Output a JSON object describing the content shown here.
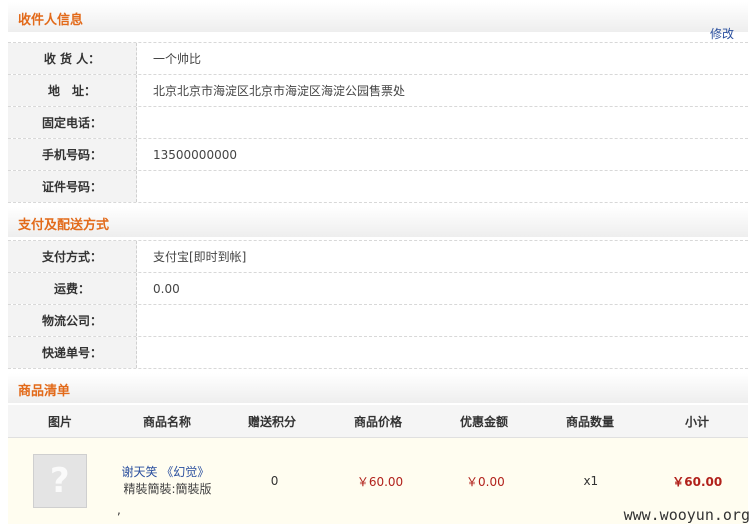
{
  "receiver": {
    "title": "收件人信息",
    "edit_label": "修改",
    "rows": [
      {
        "label": "收 货 人：",
        "value": "一个帅比"
      },
      {
        "label": "地　址：",
        "value": "北京北京市海淀区北京市海淀区海淀公园售票处"
      },
      {
        "label": "固定电话：",
        "value": ""
      },
      {
        "label": "手机号码：",
        "value": "13500000000"
      },
      {
        "label": "证件号码：",
        "value": ""
      }
    ]
  },
  "payment": {
    "title": "支付及配送方式",
    "rows": [
      {
        "label": "支付方式：",
        "value": "支付宝[即时到帐]"
      },
      {
        "label": "运费：",
        "value": "0.00"
      },
      {
        "label": "物流公司：",
        "value": ""
      },
      {
        "label": "快递单号：",
        "value": ""
      }
    ]
  },
  "goods": {
    "title": "商品清单",
    "columns": [
      "图片",
      "商品名称",
      "赠送积分",
      "商品价格",
      "优惠金额",
      "商品数量",
      "小计"
    ],
    "items": [
      {
        "thumb_icon": "placeholder-image-icon",
        "thumb_glyph": "?",
        "name": "谢天笑 《幻觉》",
        "variant": "精裝簡裝:簡裝版",
        "points": "0",
        "price": "￥60.00",
        "discount": "￥0.00",
        "quantity": "x1",
        "subtotal": "￥60.00"
      }
    ],
    "stray_mark": ","
  },
  "watermark": "www.wooyun.org"
}
